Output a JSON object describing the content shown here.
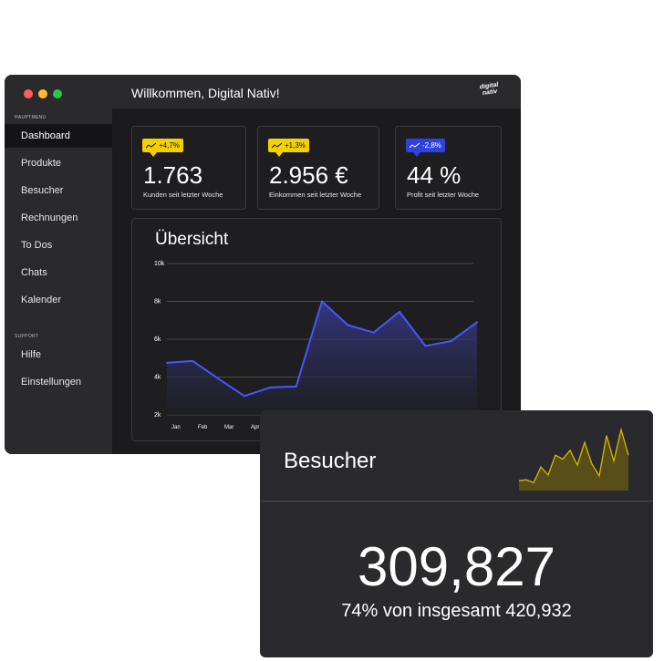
{
  "window": {
    "title": "Willkommen, Digital Nativ!",
    "logo_text": "digital nativ",
    "traffic_colors": [
      "#ff5f57",
      "#febc2e",
      "#28c840"
    ]
  },
  "sidebar": {
    "main_label": "HAUPTMENU",
    "items": [
      {
        "label": "Dashboard",
        "active": true
      },
      {
        "label": "Produkte"
      },
      {
        "label": "Besucher"
      },
      {
        "label": "Rechnungen"
      },
      {
        "label": "To Dos"
      },
      {
        "label": "Chats"
      },
      {
        "label": "Kalender"
      }
    ],
    "support_label": "SUPPORT",
    "support_items": [
      {
        "label": "Hilfe"
      },
      {
        "label": "Einstellungen"
      }
    ]
  },
  "stats": [
    {
      "badge": "+4,7%",
      "badge_color": "#f5d000",
      "value": "1.763",
      "label": "Kunden seit letzter Woche"
    },
    {
      "badge": "+1,3%",
      "badge_color": "#f5d000",
      "value": "2.956 €",
      "label": "Einkommen seit letzter Woche"
    },
    {
      "badge": "-2,8%",
      "badge_color": "#2f41e0",
      "value": "44 %",
      "label": "Profit seit letzter Woche"
    }
  ],
  "overview": {
    "title": "Übersicht"
  },
  "chart_data": {
    "type": "area",
    "title": "Übersicht",
    "x": [
      "Jan",
      "Feb",
      "Mar",
      "Apr",
      "",
      "",
      "",
      "",
      "",
      "",
      "",
      ""
    ],
    "x_labels_visible": [
      "Jan",
      "Feb",
      "Mar",
      "Apr"
    ],
    "y_ticks": [
      "2k",
      "4k",
      "6k",
      "8k",
      "10k"
    ],
    "ylim": [
      2000,
      10000
    ],
    "series": [
      {
        "values": [
          4750,
          4850,
          3900,
          3000,
          3450,
          3500,
          8000,
          6750,
          6350,
          7450,
          5650,
          5900,
          6900
        ]
      }
    ],
    "line_color": "#4a55ff",
    "grid": true
  },
  "visitor_card": {
    "title": "Besucher",
    "value": "309,827",
    "subtitle": "74% von insgesamt 420,932",
    "sparkline": [
      2,
      2.2,
      1.6,
      4.8,
      3.2,
      7.2,
      6.4,
      8.2,
      5.2,
      9.8,
      5.4,
      3,
      11.2,
      6,
      12.4,
      7.2
    ],
    "spark_color": "#d4b800"
  }
}
